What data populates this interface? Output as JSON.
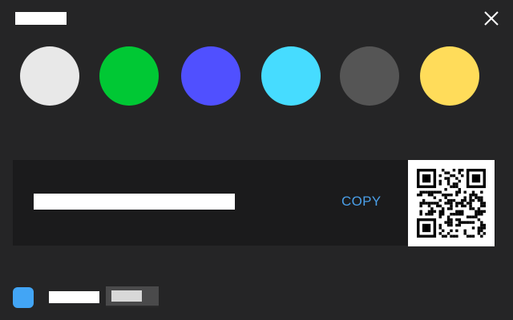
{
  "header": {
    "close_icon": "close-icon"
  },
  "swatches": [
    {
      "name": "swatch-light-gray",
      "color": "#e8e8e8"
    },
    {
      "name": "swatch-green",
      "color": "#00c834"
    },
    {
      "name": "swatch-blue",
      "color": "#5050ff"
    },
    {
      "name": "swatch-cyan",
      "color": "#46dcff"
    },
    {
      "name": "swatch-dark-gray",
      "color": "#555555"
    },
    {
      "name": "swatch-yellow",
      "color": "#ffdc5a"
    }
  ],
  "share": {
    "copy_label": "COPY",
    "qr_icon": "qr-code-icon"
  },
  "footer": {
    "accent_color": "#42a5f5"
  }
}
